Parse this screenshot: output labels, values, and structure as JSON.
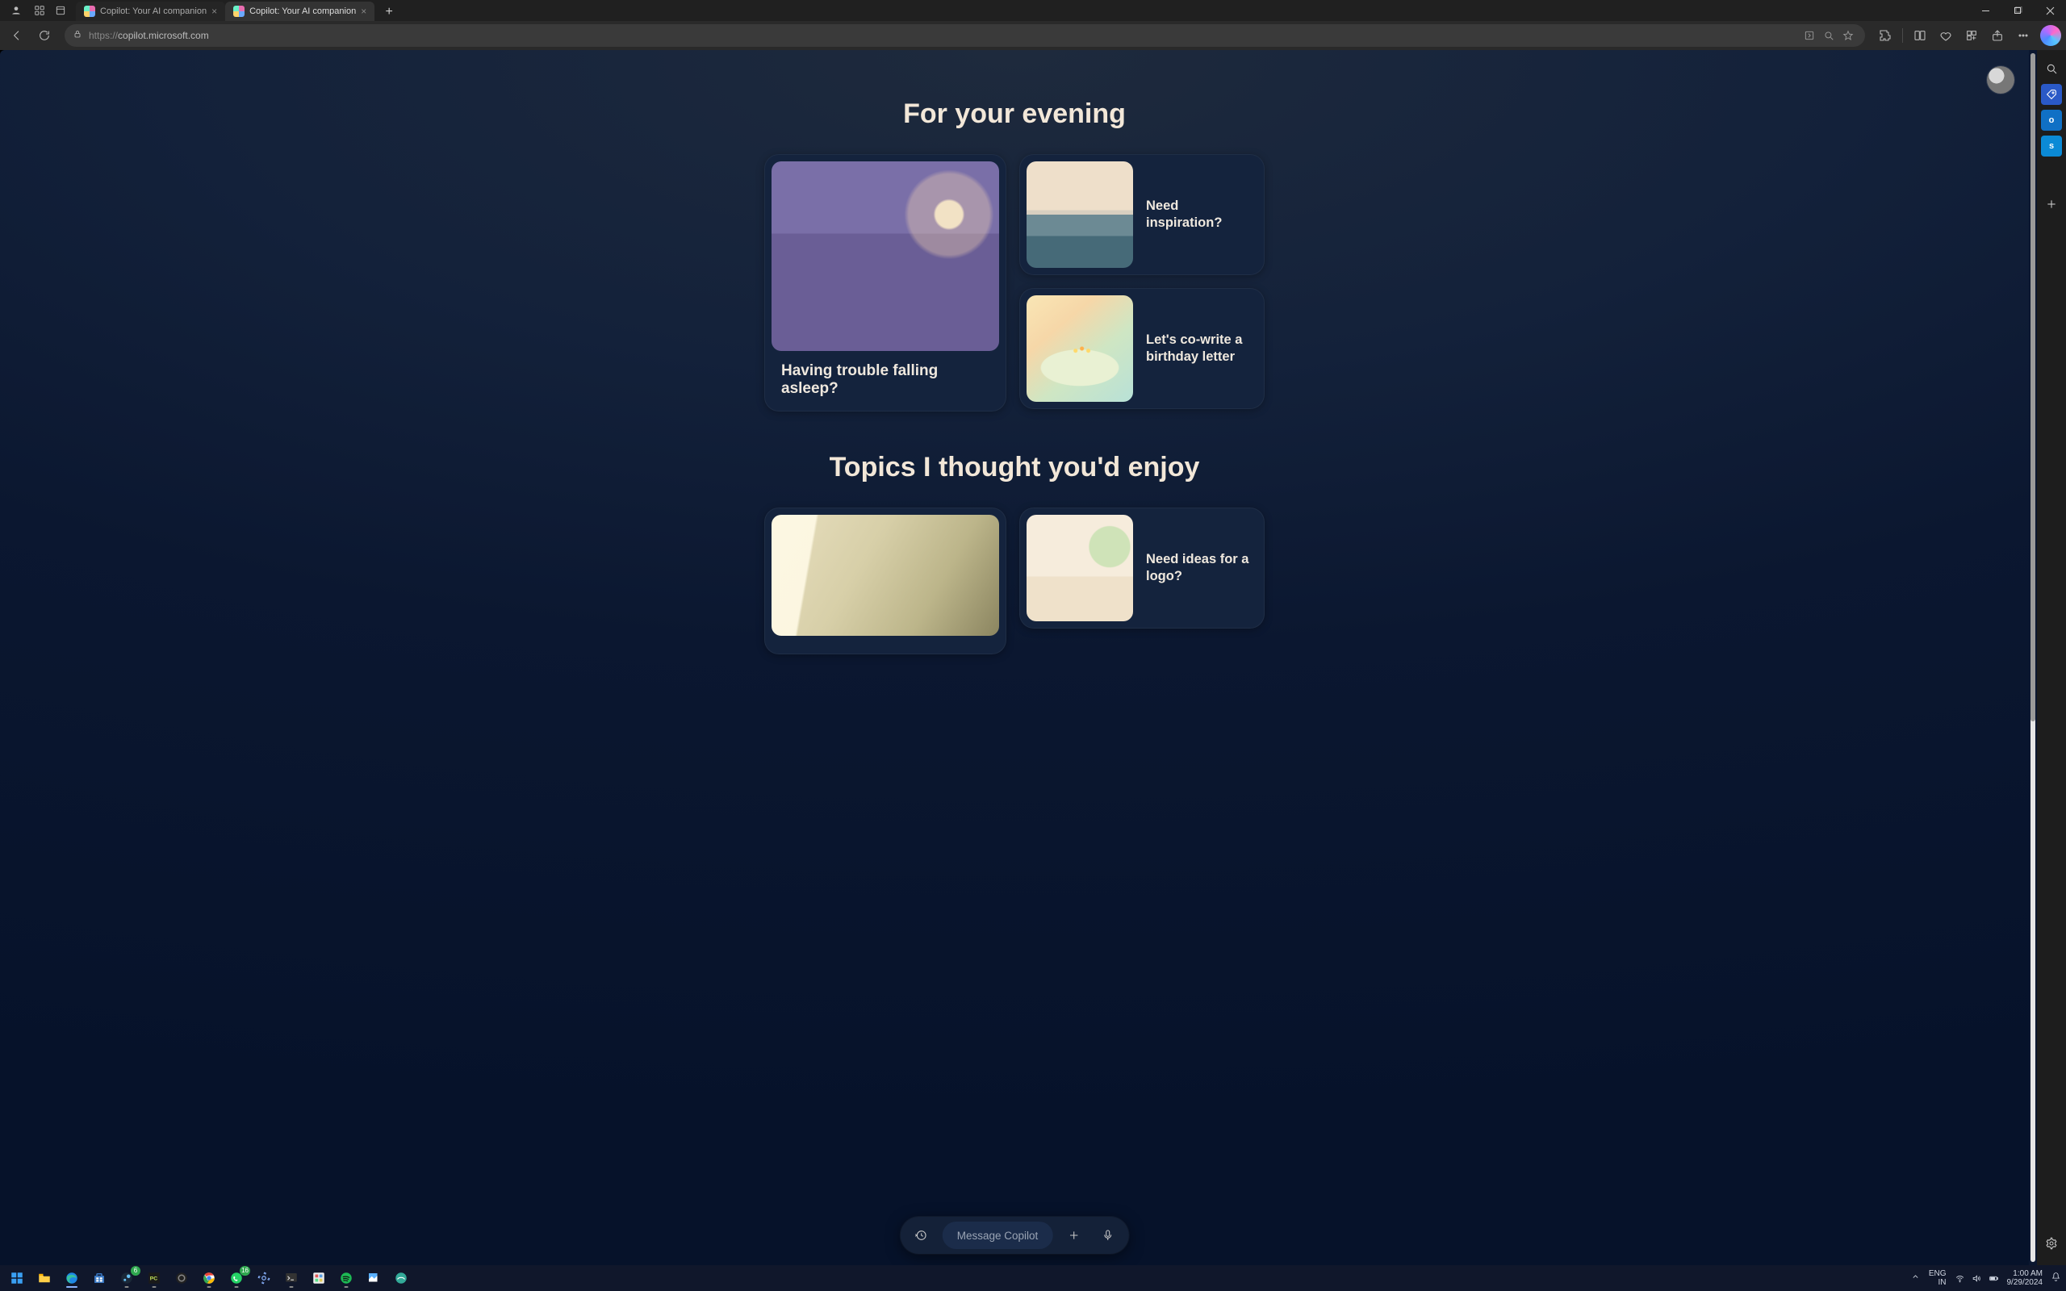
{
  "titlebar": {
    "tabs": [
      {
        "label": "Copilot: Your AI companion"
      },
      {
        "label": "Copilot: Your AI companion"
      }
    ]
  },
  "toolbar": {
    "url_scheme": "https://",
    "url_rest": "copilot.microsoft.com"
  },
  "page": {
    "heading1": "For your evening",
    "card_sleep": "Having trouble falling asleep?",
    "card_inspiration": "Need inspiration?",
    "card_birthday": "Let's co-write a birthday letter",
    "heading2": "Topics I thought you'd enjoy",
    "card_logo": "Need ideas for a logo?"
  },
  "msgbar": {
    "placeholder": "Message Copilot"
  },
  "systray": {
    "lang1": "ENG",
    "lang2": "IN",
    "time": "1:00 AM",
    "date": "9/29/2024",
    "whatsapp_badge": "16",
    "steam_badge": "6"
  }
}
